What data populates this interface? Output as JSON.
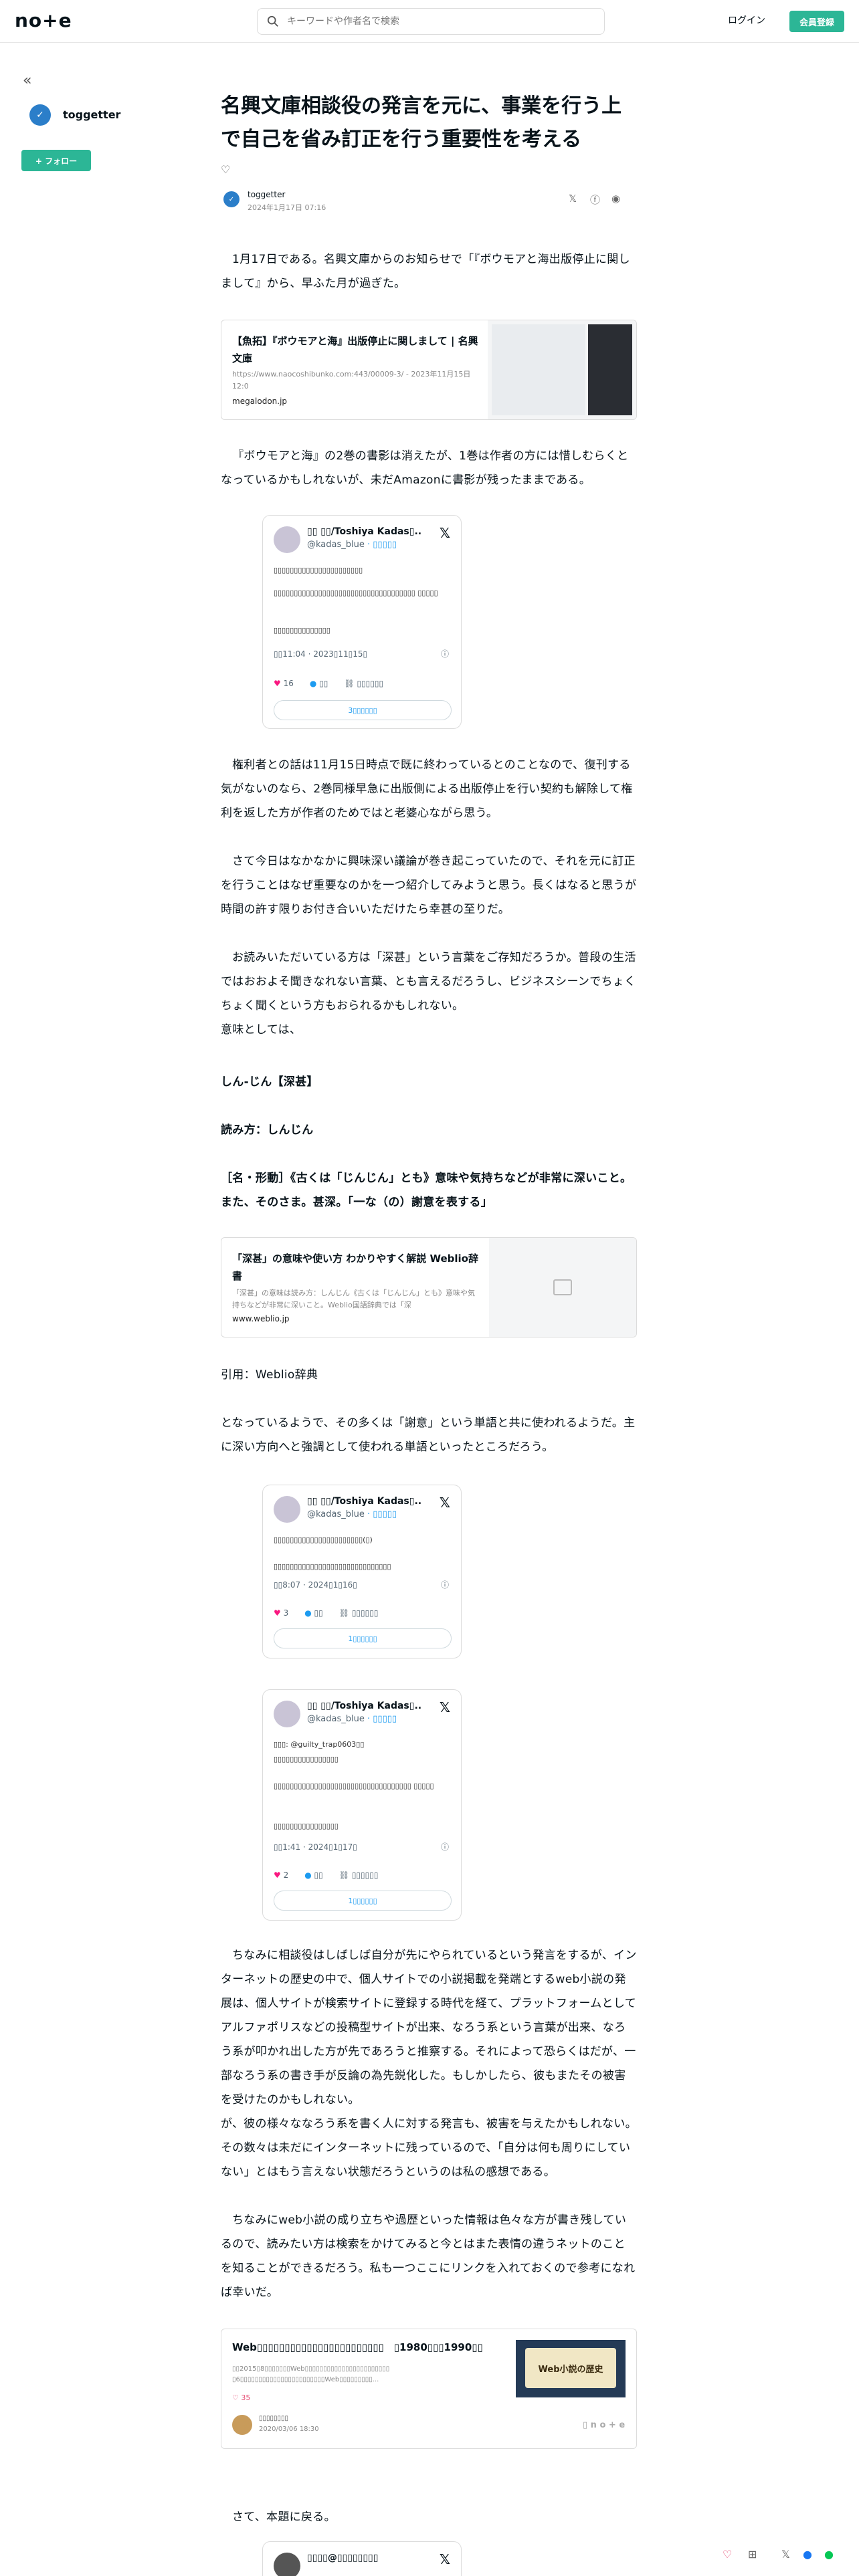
{
  "header": {
    "logo": "no+e",
    "search_placeholder": "キーワードや作者名で検索",
    "login": "ログイン",
    "signup": "会員登録"
  },
  "sidebar": {
    "collapse": "«",
    "name": "toggetter",
    "follow": "+ フォロー"
  },
  "article": {
    "title": "名興文庫相談役の発言を元に、事業を行う上で自己を省み訂正を行う重要性を考える",
    "author": "toggetter",
    "date": "2024年1月17日 07:16",
    "p1": "1月17日である。名興文庫からのお知らせで「『ボウモアと海出版停止に関しまして』から、早ふた月が過ぎた。",
    "card1": {
      "title": "【魚拓】『ボウモアと海』出版停止に関しまして | 名興文庫",
      "desc": "https://www.naocoshibunko.com:443/00009-3/ - 2023年11月15日 12:0",
      "url": "megalodon.jp"
    },
    "p2": "『ボウモアと海』の2巻の書影は消えたが、1巻は作者の方には惜しむらくとなっているかもしれないが、未だAmazonに書影が残ったままである。",
    "tweet1": {
      "name": "▯▯ ▯▯/Toshiya Kadas▯...",
      "handle": "@kadas_blue",
      "follow": "· ▯▯▯▯▯",
      "l1": "▯▯▯▯▯▯▯▯▯▯▯▯▯▯▯▯▯▯▯▯▯▯",
      "l2": "▯▯▯▯▯▯▯▯▯▯▯▯▯▯▯▯▯▯▯▯▯▯▯▯▯▯▯▯▯▯▯▯▯▯▯ ▯▯▯▯▯",
      "l3": "▯▯▯▯▯▯▯▯▯▯▯▯▯▯",
      "time": "▯▯11:04 · 2023▯11▯15▯",
      "likes": "16",
      "reply": "▯▯",
      "copy": "▯▯▯▯▯▯",
      "more": "3▯▯▯▯▯▯"
    },
    "p3": "権利者との話は11月15日時点で既に終わっているとのことなので、復刊する気がないのなら、2巻同様早急に出版側による出版停止を行い契約も解除して権利を返した方が作者のためではと老婆心ながら思う。",
    "p4": "さて今日はなかなかに興味深い議論が巻き起こっていたので、それを元に訂正を行うことはなぜ重要なのかを一つ紹介してみようと思う。長くはなると思うが時間の許す限りお付き合いいただけたら幸甚の至りだ。",
    "p5": "お読みいただいている方は「深甚」という言葉をご存知だろうか。普段の生活ではおおよそ聞きなれない言葉、とも言えるだろうし、ビジネスシーンでちょくちょく聞くという方もおられるかもしれない。\n意味としては、",
    "d1": "しん‐じん【深甚】",
    "d2": "読み方：しんじん",
    "d3": "［名・形動］《古くは「じんじん」とも》意味や気持ちなどが非常に深いこと。また、そのさま。甚深。「一な（の）謝意を表する」",
    "card2": {
      "title": "「深甚」の意味や使い方 わかりやすく解説 Weblio辞書",
      "desc": "「深甚」の意味は読み方：しんじん《古くは「じんじん」とも》意味や気持ちなどが非常に深いこと。Weblio国語辞典では「深",
      "url": "www.weblio.jp"
    },
    "cite": "引用：Weblio辞典",
    "p6": "となっているようで、その多くは「謝意」という単語と共に使われるようだ。主に深い方向へと強調として使われる単語といったところだろう。",
    "tweet2": {
      "name": "▯▯ ▯▯/Toshiya Kadas▯...",
      "handle": "@kadas_blue",
      "follow": "· ▯▯▯▯▯",
      "l1": "▯▯▯▯▯▯▯▯▯▯▯▯▯▯▯▯▯▯▯▯▯▯(▯)",
      "l2": "▯▯▯▯▯▯▯▯▯▯▯▯▯▯▯▯▯▯▯▯▯▯▯▯▯▯▯▯▯",
      "time": "▯▯8:07 · 2024▯1▯16▯",
      "likes": "3",
      "reply": "▯▯",
      "copy": "▯▯▯▯▯▯",
      "more": "1▯▯▯▯▯▯"
    },
    "tweet3": {
      "name": "▯▯ ▯▯/Toshiya Kadas▯...",
      "handle": "@kadas_blue",
      "follow": "· ▯▯▯▯▯",
      "l0": "▯▯▯: @guilty_trap0603▯▯",
      "l1": "▯▯▯▯▯▯▯▯▯▯▯▯▯▯▯▯",
      "l2": "▯▯▯▯▯▯▯▯▯▯▯▯▯▯▯▯▯▯▯▯▯▯▯▯▯▯▯▯▯▯▯▯▯▯ ▯▯▯▯▯",
      "l3": "▯▯▯▯▯▯▯▯▯▯▯▯▯▯▯▯",
      "time": "▯▯1:41 · 2024▯1▯17▯",
      "likes": "2",
      "reply": "▯▯",
      "copy": "▯▯▯▯▯▯",
      "more": "1▯▯▯▯▯▯"
    },
    "p7": "ちなみに相談役はしばしば自分が先にやられているという発言をするが、インターネットの歴史の中で、個人サイトでの小説掲載を発端とするweb小説の発展は、個人サイトが検索サイトに登録する時代を経て、プラットフォームとしてアルファポリスなどの投稿型サイトが出来、なろう系という言葉が出来、なろう系が叩かれ出した方が先であろうと推察する。それによって恐らくはだが、一部なろう系の書き手が反論の為先鋭化した。もしかしたら、彼もまたその被害を受けたのかもしれない。\nが、彼の様々ななろう系を書く人に対する発言も、被害を与えたかもしれない。その数々は未だにインターネットに残っているので、「自分は何も周りにしていない」とはもう言えない状態だろうというのは私の感想である。",
    "p8": "ちなみにweb小説の成り立ちや過歴といった情報は色々な方が書き残しているので、読みたい方は検索をかけてみると今とはまた表情の違うネットのことを知ることができるだろう。私も一つここにリンクを入れておくので参考になれば幸いだ。",
    "ncard": {
      "title": "Web▯▯▯▯▯▯▯▯▯▯▯▯▯▯▯▯▯▯▯▯▯▯▯　▯1980▯▯▯1990▯▯",
      "desc": "▯▯2015▯8▯▯▯▯▯▯▯Web▯▯▯▯▯▯▯▯▯▯▯▯▯▯▯▯▯▯▯▯▯▯▯　▯6▯▯▯▯▯▯▯▯▯▯▯▯▯▯▯▯▯▯▯▯▯▯▯Web▯▯▯▯▯▯▯▯▯...",
      "likes": "35",
      "author": "▯▯▯▯▯▯▯▯",
      "date": "2020/03/06 18:30",
      "thumb": "Web小説の歴史"
    },
    "p9": "さて、本題に戻る。",
    "tweet4": {
      "name": "▯▯▯▯@▯▯▯▯▯▯▯▯"
    }
  }
}
